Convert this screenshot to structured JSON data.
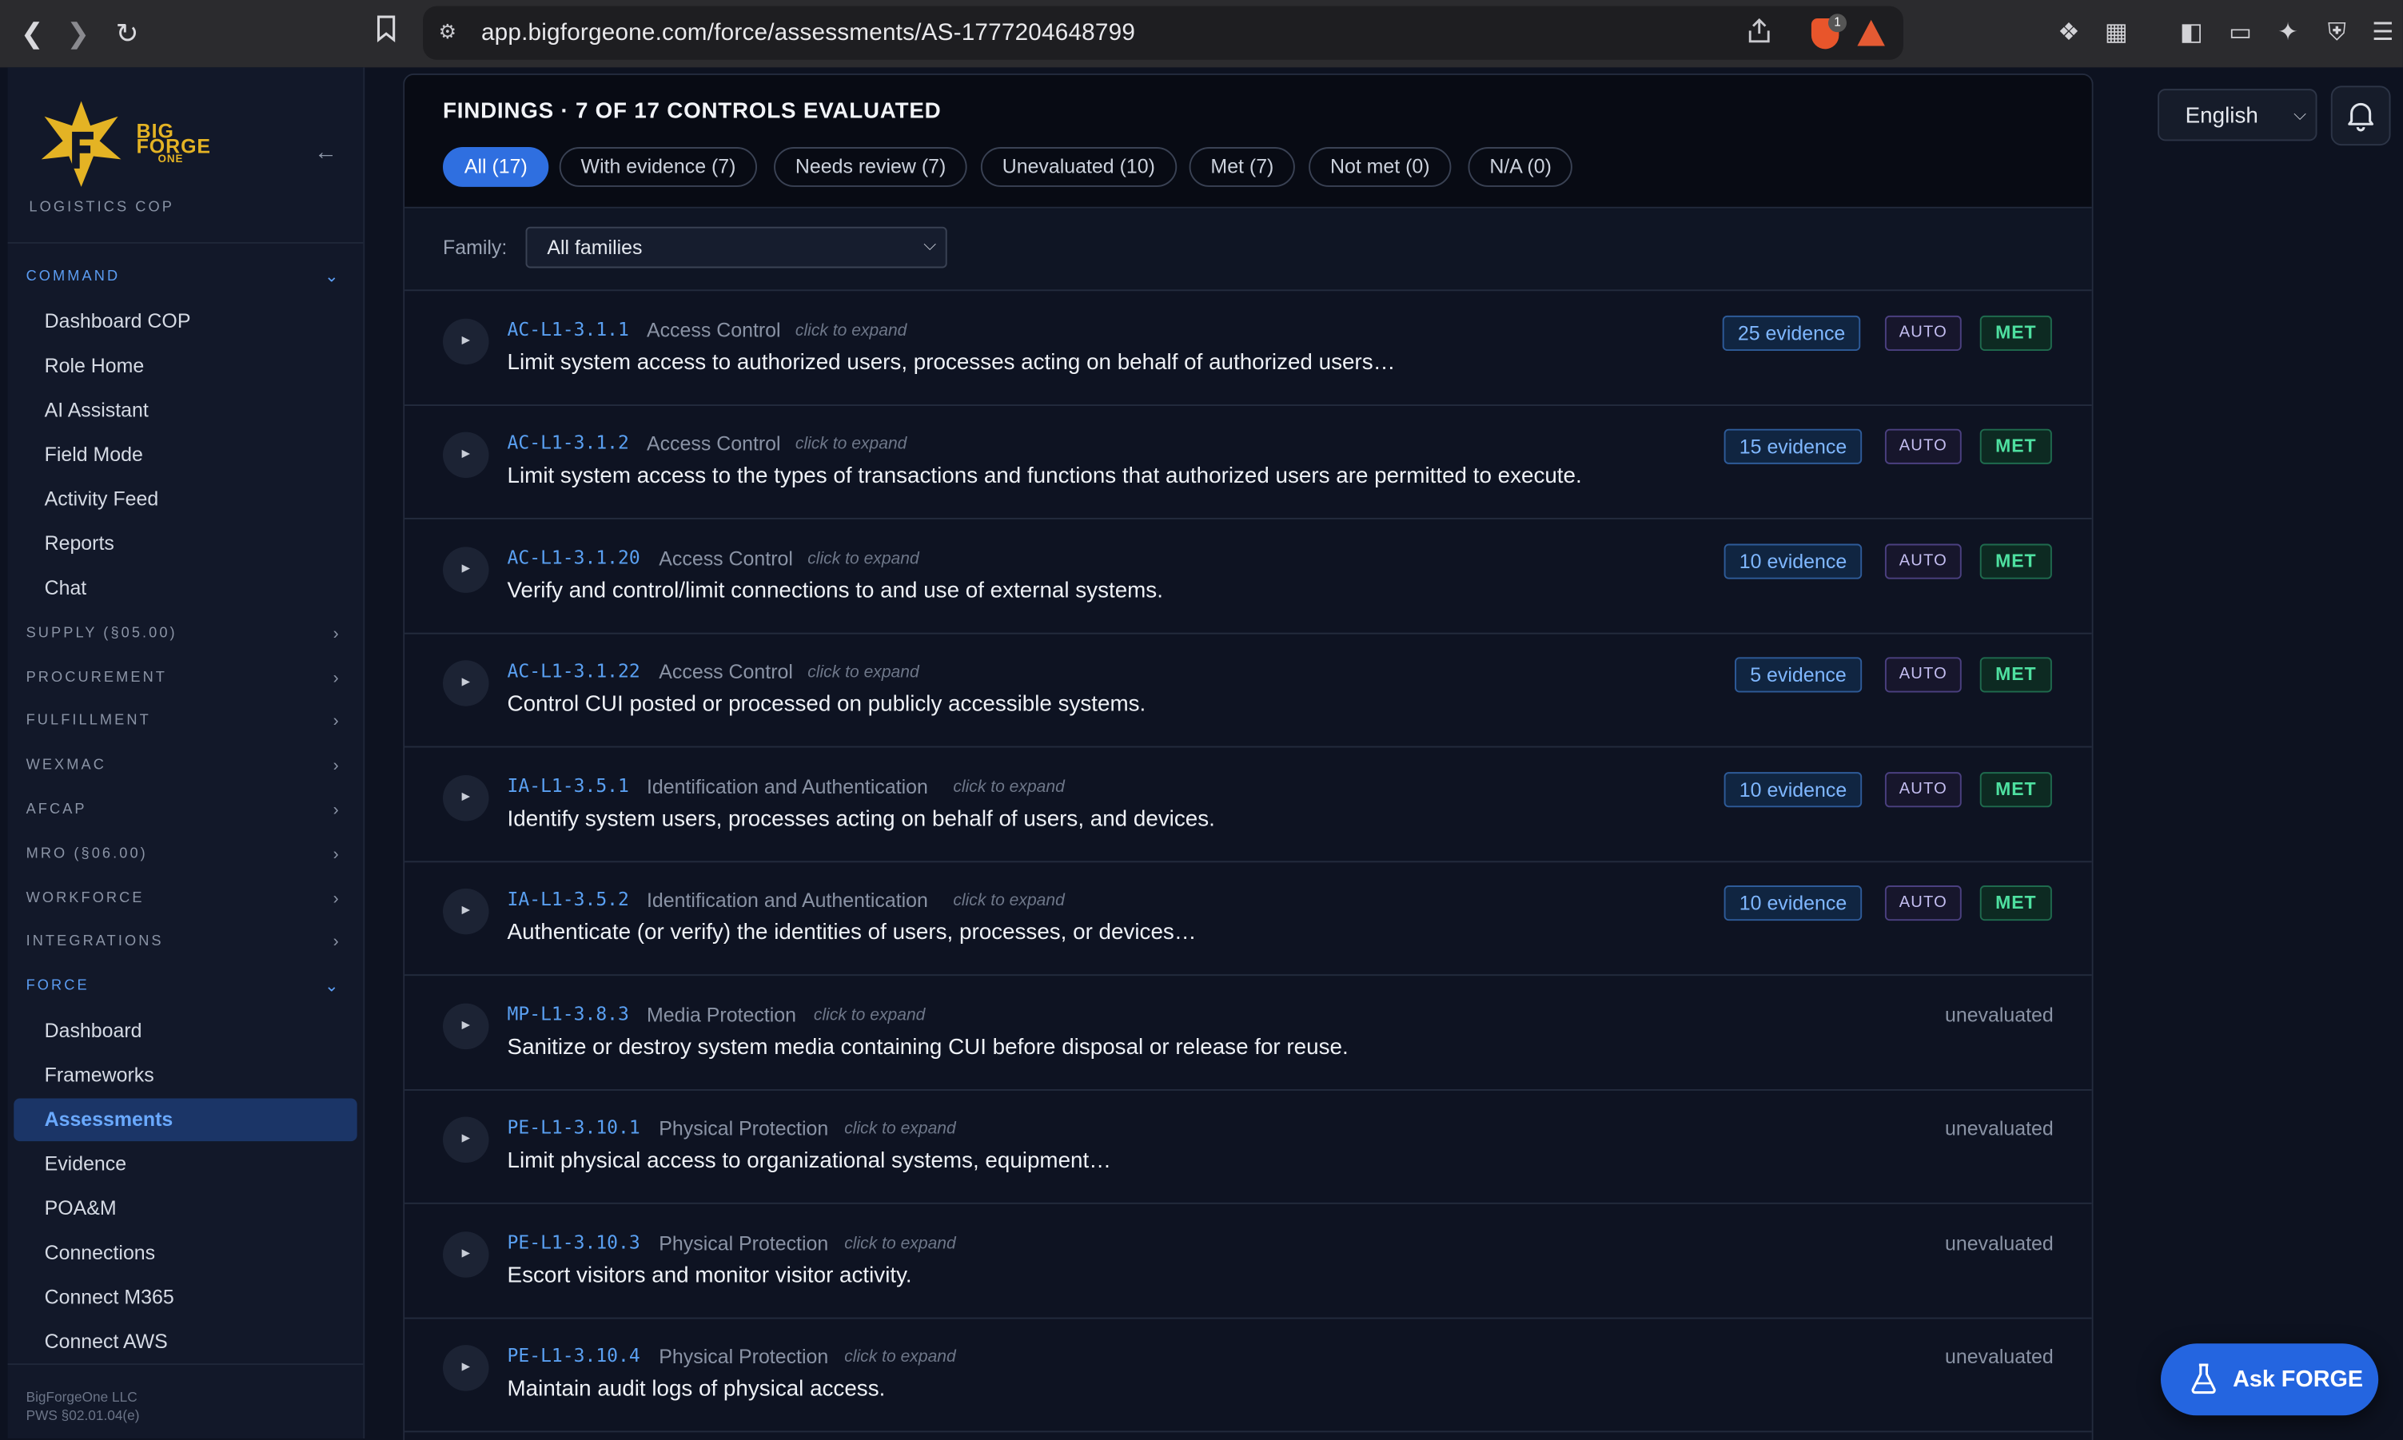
{
  "browser": {
    "url": "app.bigforgeone.com/force/assessments/AS-1777204648799",
    "shield_badge": "1"
  },
  "sidebar": {
    "brand_line1": "BIG",
    "brand_line2": "FORGE",
    "brand_line3": "ONE",
    "subtitle": "LOGISTICS COP",
    "sections": [
      {
        "label": "COMMAND",
        "expanded": true,
        "items": [
          "Dashboard COP",
          "Role Home",
          "AI Assistant",
          "Field Mode",
          "Activity Feed",
          "Reports",
          "Chat"
        ]
      },
      {
        "label": "SUPPLY (§05.00)",
        "expanded": false
      },
      {
        "label": "PROCUREMENT",
        "expanded": false
      },
      {
        "label": "FULFILLMENT",
        "expanded": false
      },
      {
        "label": "WEXMAC",
        "expanded": false
      },
      {
        "label": "AFCAP",
        "expanded": false
      },
      {
        "label": "MRO (§06.00)",
        "expanded": false
      },
      {
        "label": "WORKFORCE",
        "expanded": false
      },
      {
        "label": "INTEGRATIONS",
        "expanded": false
      },
      {
        "label": "FORCE",
        "expanded": true,
        "items": [
          "Dashboard",
          "Frameworks",
          "Assessments",
          "Evidence",
          "POA&M",
          "Connections",
          "Connect M365",
          "Connect AWS"
        ]
      }
    ],
    "active_item": "Assessments",
    "footer_line1": "BigForgeOne LLC",
    "footer_line2": "PWS §02.01.04(e)"
  },
  "findings": {
    "title": "FINDINGS · 7 OF 17 CONTROLS EVALUATED",
    "filters": [
      "All (17)",
      "With evidence (7)",
      "Needs review (7)",
      "Unevaluated (10)",
      "Met (7)",
      "Not met (0)",
      "N/A (0)"
    ],
    "active_filter": "All (17)",
    "family_label": "Family:",
    "family_value": "All families",
    "hint": "click to expand",
    "auto_label": "AUTO",
    "met_label": "MET",
    "unevaluated_label": "unevaluated",
    "controls": [
      {
        "id": "AC-L1-3.1.1",
        "family": "Access Control",
        "text": "Limit system access to authorized users, processes acting on behalf of authorized users…",
        "evidence": "25 evidence",
        "status": "met"
      },
      {
        "id": "AC-L1-3.1.2",
        "family": "Access Control",
        "text": "Limit system access to the types of transactions and functions that authorized users are permitted to execute.",
        "evidence": "15 evidence",
        "status": "met"
      },
      {
        "id": "AC-L1-3.1.20",
        "family": "Access Control",
        "text": "Verify and control/limit connections to and use of external systems.",
        "evidence": "10 evidence",
        "status": "met"
      },
      {
        "id": "AC-L1-3.1.22",
        "family": "Access Control",
        "text": "Control CUI posted or processed on publicly accessible systems.",
        "evidence": "5 evidence",
        "status": "met"
      },
      {
        "id": "IA-L1-3.5.1",
        "family": "Identification and Authentication",
        "text": "Identify system users, processes acting on behalf of users, and devices.",
        "evidence": "10 evidence",
        "status": "met"
      },
      {
        "id": "IA-L1-3.5.2",
        "family": "Identification and Authentication",
        "text": "Authenticate (or verify) the identities of users, processes, or devices…",
        "evidence": "10 evidence",
        "status": "met"
      },
      {
        "id": "MP-L1-3.8.3",
        "family": "Media Protection",
        "text": "Sanitize or destroy system media containing CUI before disposal or release for reuse.",
        "evidence": "",
        "status": "unevaluated"
      },
      {
        "id": "PE-L1-3.10.1",
        "family": "Physical Protection",
        "text": "Limit physical access to organizational systems, equipment…",
        "evidence": "",
        "status": "unevaluated"
      },
      {
        "id": "PE-L1-3.10.3",
        "family": "Physical Protection",
        "text": "Escort visitors and monitor visitor activity.",
        "evidence": "",
        "status": "unevaluated"
      },
      {
        "id": "PE-L1-3.10.4",
        "family": "Physical Protection",
        "text": "Maintain audit logs of physical access.",
        "evidence": "",
        "status": "unevaluated"
      }
    ]
  },
  "header": {
    "language": "English"
  },
  "ask_button": "Ask FORGE",
  "colors": {
    "accent": "#2f6fe0",
    "brand_gold": "#e4b324",
    "met_green": "#4ee0a0",
    "control_id_blue": "#5aa0f2"
  }
}
